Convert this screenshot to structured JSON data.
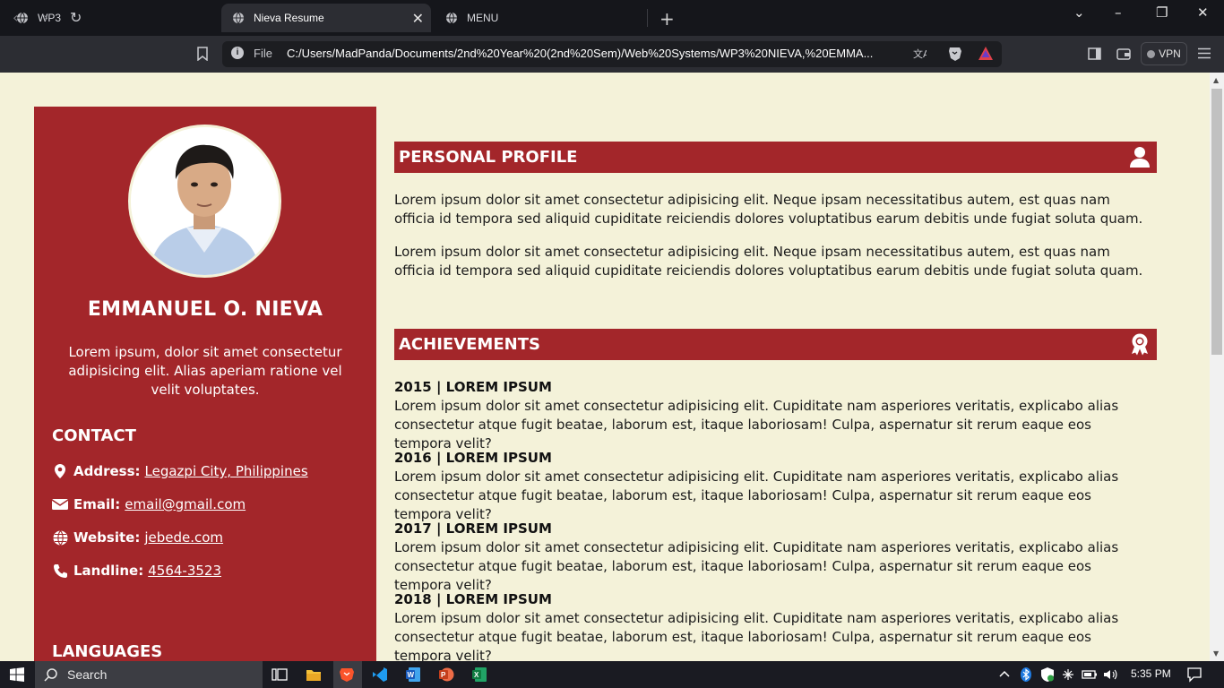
{
  "browser": {
    "tabs": [
      {
        "label": "WP3",
        "active": false
      },
      {
        "label": "Nieva Resume",
        "active": true
      },
      {
        "label": "MENU",
        "active": false
      }
    ],
    "url_scheme_label": "File",
    "url": "C:/Users/MadPanda/Documents/2nd%20Year%20(2nd%20Sem)/Web%20Systems/WP3%20NIEVA,%20EMMA...",
    "vpn_label": "VPN"
  },
  "resume": {
    "name": "EMMANUEL O. NIEVA",
    "tagline": "Lorem ipsum, dolor sit amet consectetur adipisicing elit. Alias aperiam ratione vel velit voluptates.",
    "contact": {
      "title": "CONTACT",
      "items": [
        {
          "label": "Address:",
          "value": "Legazpi City, Philippines",
          "icon": "map-pin-icon"
        },
        {
          "label": "Email:",
          "value": "email@gmail.com",
          "icon": "envelope-icon"
        },
        {
          "label": "Website:",
          "value": "jebede.com",
          "icon": "globe-icon"
        },
        {
          "label": "Landline:",
          "value": "4564-3523",
          "icon": "phone-icon"
        }
      ]
    },
    "languages_title": "LANGUAGES",
    "profile": {
      "title": "PERSONAL PROFILE",
      "paragraphs": [
        "Lorem ipsum dolor sit amet consectetur adipisicing elit. Neque ipsam necessitatibus autem, est quas nam officia id tempora sed aliquid cupiditate reiciendis dolores voluptatibus earum debitis unde fugiat soluta quam.",
        "Lorem ipsum dolor sit amet consectetur adipisicing elit. Neque ipsam necessitatibus autem, est quas nam officia id tempora sed aliquid cupiditate reiciendis dolores voluptatibus earum debitis unde fugiat soluta quam."
      ]
    },
    "achievements": {
      "title": "ACHIEVEMENTS",
      "items": [
        {
          "heading": "2015 | LOREM IPSUM",
          "text": "Lorem ipsum dolor sit amet consectetur adipisicing elit. Cupiditate nam asperiores veritatis, explicabo alias consectetur atque fugit beatae, laborum est, itaque laboriosam! Culpa, aspernatur sit rerum eaque eos tempora velit?"
        },
        {
          "heading": "2016 | LOREM IPSUM",
          "text": "Lorem ipsum dolor sit amet consectetur adipisicing elit. Cupiditate nam asperiores veritatis, explicabo alias consectetur atque fugit beatae, laborum est, itaque laboriosam! Culpa, aspernatur sit rerum eaque eos tempora velit?"
        },
        {
          "heading": "2017 | LOREM IPSUM",
          "text": "Lorem ipsum dolor sit amet consectetur adipisicing elit. Cupiditate nam asperiores veritatis, explicabo alias consectetur atque fugit beatae, laborum est, itaque laboriosam! Culpa, aspernatur sit rerum eaque eos tempora velit?"
        },
        {
          "heading": "2018 | LOREM IPSUM",
          "text": "Lorem ipsum dolor sit amet consectetur adipisicing elit. Cupiditate nam asperiores veritatis, explicabo alias consectetur atque fugit beatae, laborum est, itaque laboriosam! Culpa, aspernatur sit rerum eaque eos tempora velit?"
        }
      ]
    }
  },
  "taskbar": {
    "search_label": "Search",
    "clock": "5:35 PM"
  },
  "colors": {
    "accent": "#a3262a",
    "page_bg": "#f4f2d9"
  }
}
